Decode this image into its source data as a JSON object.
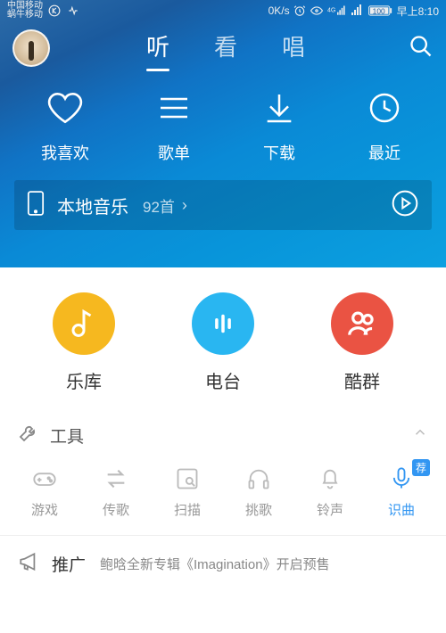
{
  "status": {
    "carrier1": "中国移动",
    "carrier2": "蜗牛移动",
    "speed": "0K/s",
    "time": "早上8:10",
    "battery": "100"
  },
  "tabs": {
    "listen": "听",
    "watch": "看",
    "sing": "唱"
  },
  "quick": {
    "like": "我喜欢",
    "playlist": "歌单",
    "download": "下载",
    "recent": "最近"
  },
  "local": {
    "label": "本地音乐",
    "count": "92首"
  },
  "categories": {
    "library": "乐库",
    "radio": "电台",
    "group": "酷群"
  },
  "tools": {
    "title": "工具",
    "items": {
      "game": "游戏",
      "transfer": "传歌",
      "scan": "扫描",
      "pick": "挑歌",
      "ring": "铃声",
      "recognize": "识曲"
    },
    "badge": "荐"
  },
  "promo": {
    "title": "推广",
    "text": "鲍晗全新专辑《Imagination》开启预售"
  }
}
